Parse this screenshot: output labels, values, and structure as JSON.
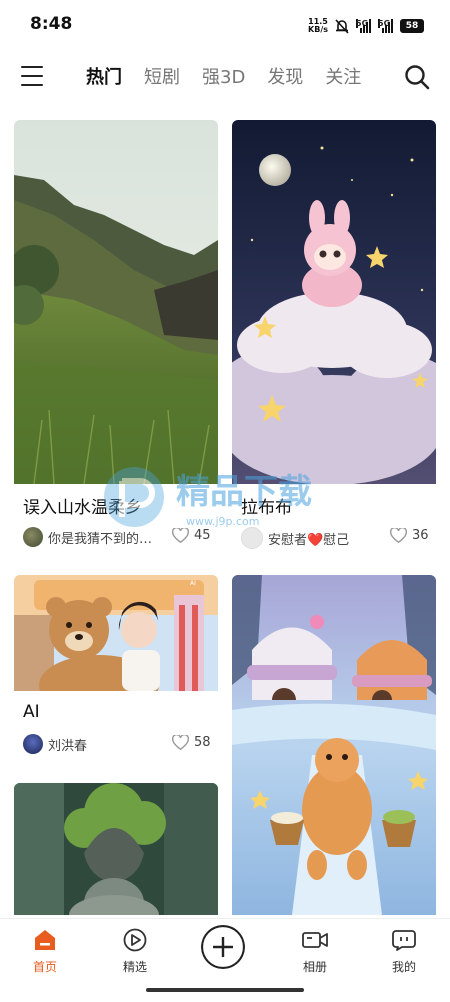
{
  "status_bar": {
    "time": "8:48",
    "net_speed_value": "11.5",
    "net_speed_unit": "KB/s",
    "signal1": "5G",
    "signal2": "5G",
    "battery": "58"
  },
  "nav": {
    "tabs": [
      "热门",
      "短剧",
      "强3D",
      "发现",
      "关注"
    ],
    "active_tab": 0
  },
  "cards": [
    {
      "title": "误入山水温柔乡",
      "author": "你是我猜不到的…",
      "likes": "45"
    },
    {
      "title": "拉布布",
      "author": "安慰者❤️慰己",
      "likes": "36"
    },
    {
      "title": "AI",
      "author": "刘洪春",
      "likes": "58"
    },
    {
      "title": "",
      "author": "",
      "likes": ""
    }
  ],
  "bottom_nav": {
    "items": [
      "首页",
      "精选",
      "相册",
      "我的"
    ],
    "active": "首页"
  },
  "watermark": {
    "text": "精品下载",
    "url": "www.j9p.com"
  },
  "colors": {
    "accent": "#e85d1f"
  }
}
